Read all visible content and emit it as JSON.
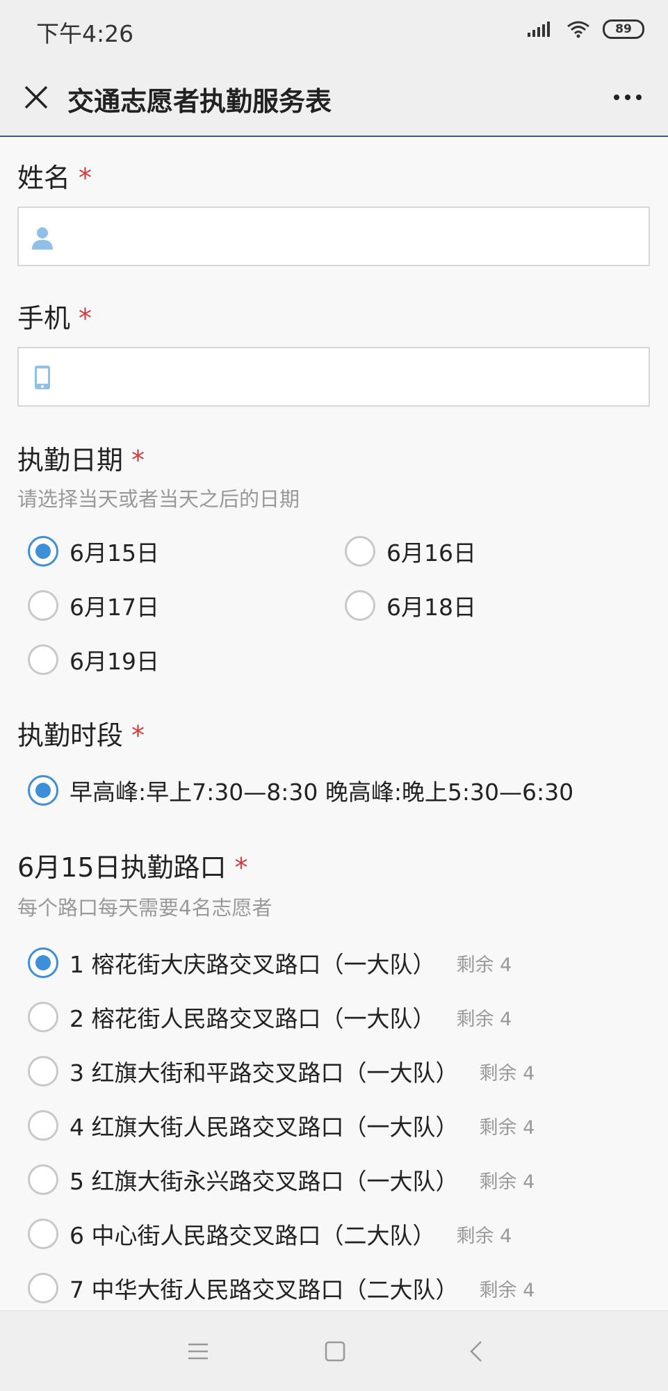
{
  "status_bar": {
    "time": "下午4:26",
    "battery": "89"
  },
  "header": {
    "title": "交通志愿者执勤服务表"
  },
  "form": {
    "required_mark": "*",
    "name": {
      "label": "姓名",
      "value": "",
      "placeholder": ""
    },
    "phone": {
      "label": "手机",
      "value": "",
      "placeholder": ""
    },
    "date": {
      "label": "执勤日期",
      "description": "请选择当天或者当天之后的日期",
      "options": [
        "6月15日",
        "6月16日",
        "6月17日",
        "6月18日",
        "6月19日"
      ],
      "selected": "6月15日"
    },
    "period": {
      "label": "执勤时段",
      "options": [
        "早高峰:早上7:30—8:30 晚高峰:晚上5:30—6:30"
      ],
      "selected": "早高峰:早上7:30—8:30 晚高峰:晚上5:30—6:30"
    },
    "intersection": {
      "label": "6月15日执勤路口",
      "description": "每个路口每天需要4名志愿者",
      "options": [
        {
          "label": "1 榕花街大庆路交叉路口（一大队）",
          "remaining": "剩余 4"
        },
        {
          "label": "2 榕花街人民路交叉路口（一大队）",
          "remaining": "剩余 4"
        },
        {
          "label": "3 红旗大街和平路交叉路口（一大队）",
          "remaining": "剩余 4"
        },
        {
          "label": "4 红旗大街人民路交叉路口（一大队）",
          "remaining": "剩余 4"
        },
        {
          "label": "5 红旗大街永兴路交叉路口（一大队）",
          "remaining": "剩余 4"
        },
        {
          "label": "6 中心街人民路交叉路口（二大队）",
          "remaining": "剩余 4"
        },
        {
          "label": "7 中华大街人民路交叉路口（二大队）",
          "remaining": "剩余 4"
        }
      ],
      "selected_index": 0
    }
  },
  "icons": {
    "person": "person-icon",
    "phone": "phone-icon",
    "close": "close-icon",
    "more": "more-dots-icon"
  },
  "colors": {
    "accent": "#3e8fd8",
    "required": "#d23b3b",
    "icon_blue": "#8fc0e6",
    "header_border": "#3b5a8a"
  }
}
